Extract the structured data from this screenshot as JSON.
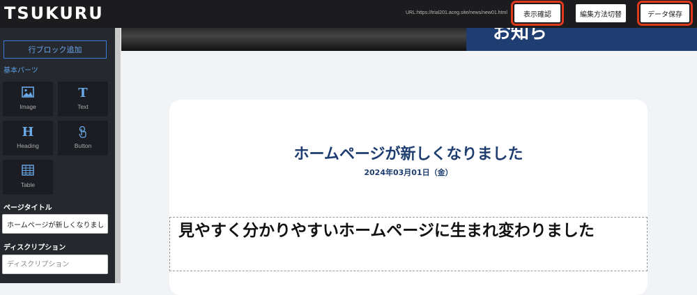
{
  "topbar": {
    "logo": "TSUKURU",
    "url": "URL:https://trial201.aceg.site/news/new01.html",
    "preview_label": "表示確認",
    "edit_mode_label": "編集方法切替",
    "save_label": "データ保存"
  },
  "sidebar": {
    "add_block_label": "行ブロック追加",
    "section_label": "基本パーツ",
    "parts": [
      {
        "label": "Image",
        "icon": "image-icon"
      },
      {
        "label": "Text",
        "icon": "text-icon"
      },
      {
        "label": "Heading",
        "icon": "heading-icon"
      },
      {
        "label": "Button",
        "icon": "button-icon"
      },
      {
        "label": "Table",
        "icon": "table-icon"
      }
    ],
    "page_title_label": "ページタイトル",
    "page_title_value": "ホームページが新しくなりました",
    "description_label": "ディスクリプション",
    "description_placeholder": "ディスクリプション"
  },
  "main": {
    "hero_text": "お知ら",
    "title": "ホームページが新しくなりました",
    "date": "2024年03月01日（金）",
    "heading": "見やすく分かりやすいホームページに生まれ変わりました"
  },
  "colors": {
    "accent": "#1e3d70",
    "highlight": "#e03a1e",
    "sidebar_bg": "#25282d"
  }
}
